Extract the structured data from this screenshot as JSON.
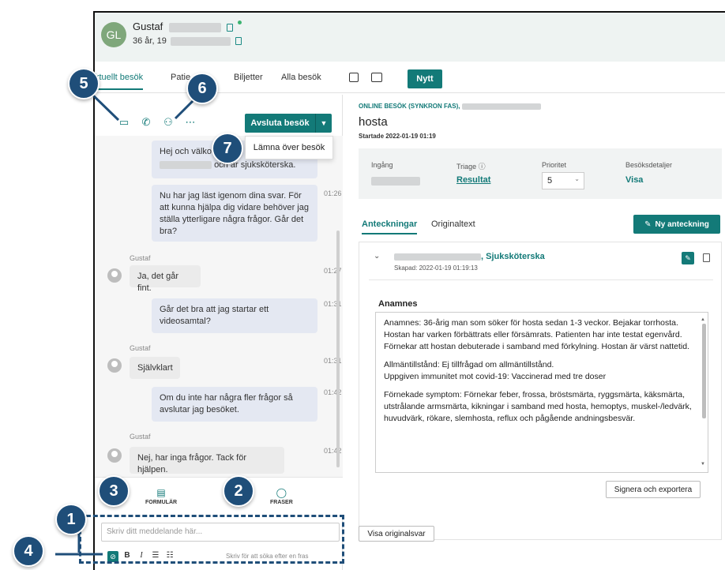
{
  "patient": {
    "initials": "GL",
    "name": "Gustaf",
    "age": "36 år, 19"
  },
  "tabs": [
    {
      "label": "ktuellt besök"
    },
    {
      "label": "Patie"
    },
    {
      "label": "Biljetter"
    },
    {
      "label": "Alla besök"
    }
  ],
  "new_button": "Nytt",
  "end_visit_button": "Avsluta besök",
  "dropdown_item": "Lämna över besök",
  "chat": {
    "messages": [
      {
        "text": "Hej och välko",
        "text2": "och är sjuksköterska.",
        "type": "out"
      },
      {
        "text": "Nu har jag läst igenom dina svar. För att kunna hjälpa dig vidare behöver jag ställa ytterligare några frågor. Går det bra?",
        "time": "01:26",
        "type": "out"
      },
      {
        "sender": "Gustaf",
        "text": "Ja, det går fint.",
        "time": "01:27",
        "type": "in"
      },
      {
        "text": "Går det bra att jag startar ett videosamtal?",
        "time": "01:31",
        "type": "out"
      },
      {
        "sender": "Gustaf",
        "text": "Självklart",
        "time": "01:31",
        "type": "in"
      },
      {
        "text": "Om du inte har några fler frågor så avslutar jag besöket.",
        "time": "01:42",
        "type": "out"
      },
      {
        "sender": "Gustaf",
        "text": "Nej, har inga frågor. Tack för hjälpen.",
        "time": "01:42",
        "type": "in"
      }
    ]
  },
  "tools": {
    "form": "FORMULÄR",
    "phrases": "FRASER"
  },
  "compose": {
    "placeholder": "Skriv ditt meddelande här...",
    "hint": "Skriv  för att söka efter en fras"
  },
  "visit": {
    "type": "ONLINE BESÖK (SYNKRON FAS),",
    "title": "hosta",
    "started": "Startade 2022-01-19 01:19"
  },
  "info": {
    "entry_label": "Ingång",
    "triage_label": "Triage ⓘ",
    "triage_value": "Resultat",
    "priority_label": "Prioritet",
    "priority_value": "5",
    "details_label": "Besöksdetaljer",
    "details_value": "Visa"
  },
  "note_tabs": {
    "notes": "Anteckningar",
    "original": "Originaltext",
    "new_note": "Ny anteckning"
  },
  "note": {
    "author_suffix": ", Sjuksköterska",
    "created": "Skapad: 2022-01-19 01:19:13",
    "anamnes_label": "Anamnes",
    "p1": "Anamnes: 36-årig man som söker för hosta sedan 1-3 veckor. Bejakar torrhosta. Hostan har varken förbättrats eller försämrats. Patienten har inte testat egenvård. Förnekar att hostan debuterade i samband med förkylning. Hostan är värst nattetid.",
    "p2a": "Allmäntillstånd: Ej tillfrågad om allmäntillstånd.",
    "p2b": "Uppgiven immunitet mot covid-19: Vaccinerad med tre doser",
    "p3": "Förnekade symptom: Förnekar feber, frossa, bröstsmärta, ryggsmärta, käksmärta, utstrålande armsmärta, kikningar i samband med hosta, hemoptys, muskel-/ledvärk, huvudvärk, rökare, slemhosta, reflux och pågående andningsbesvär.",
    "sign_button": "Signera och exportera"
  },
  "original_answers_button": "Visa originalsvar",
  "markers": [
    "1",
    "2",
    "3",
    "4",
    "5",
    "6",
    "7"
  ],
  "colors": {
    "accent": "#137a78",
    "marker": "#1f4e79"
  }
}
